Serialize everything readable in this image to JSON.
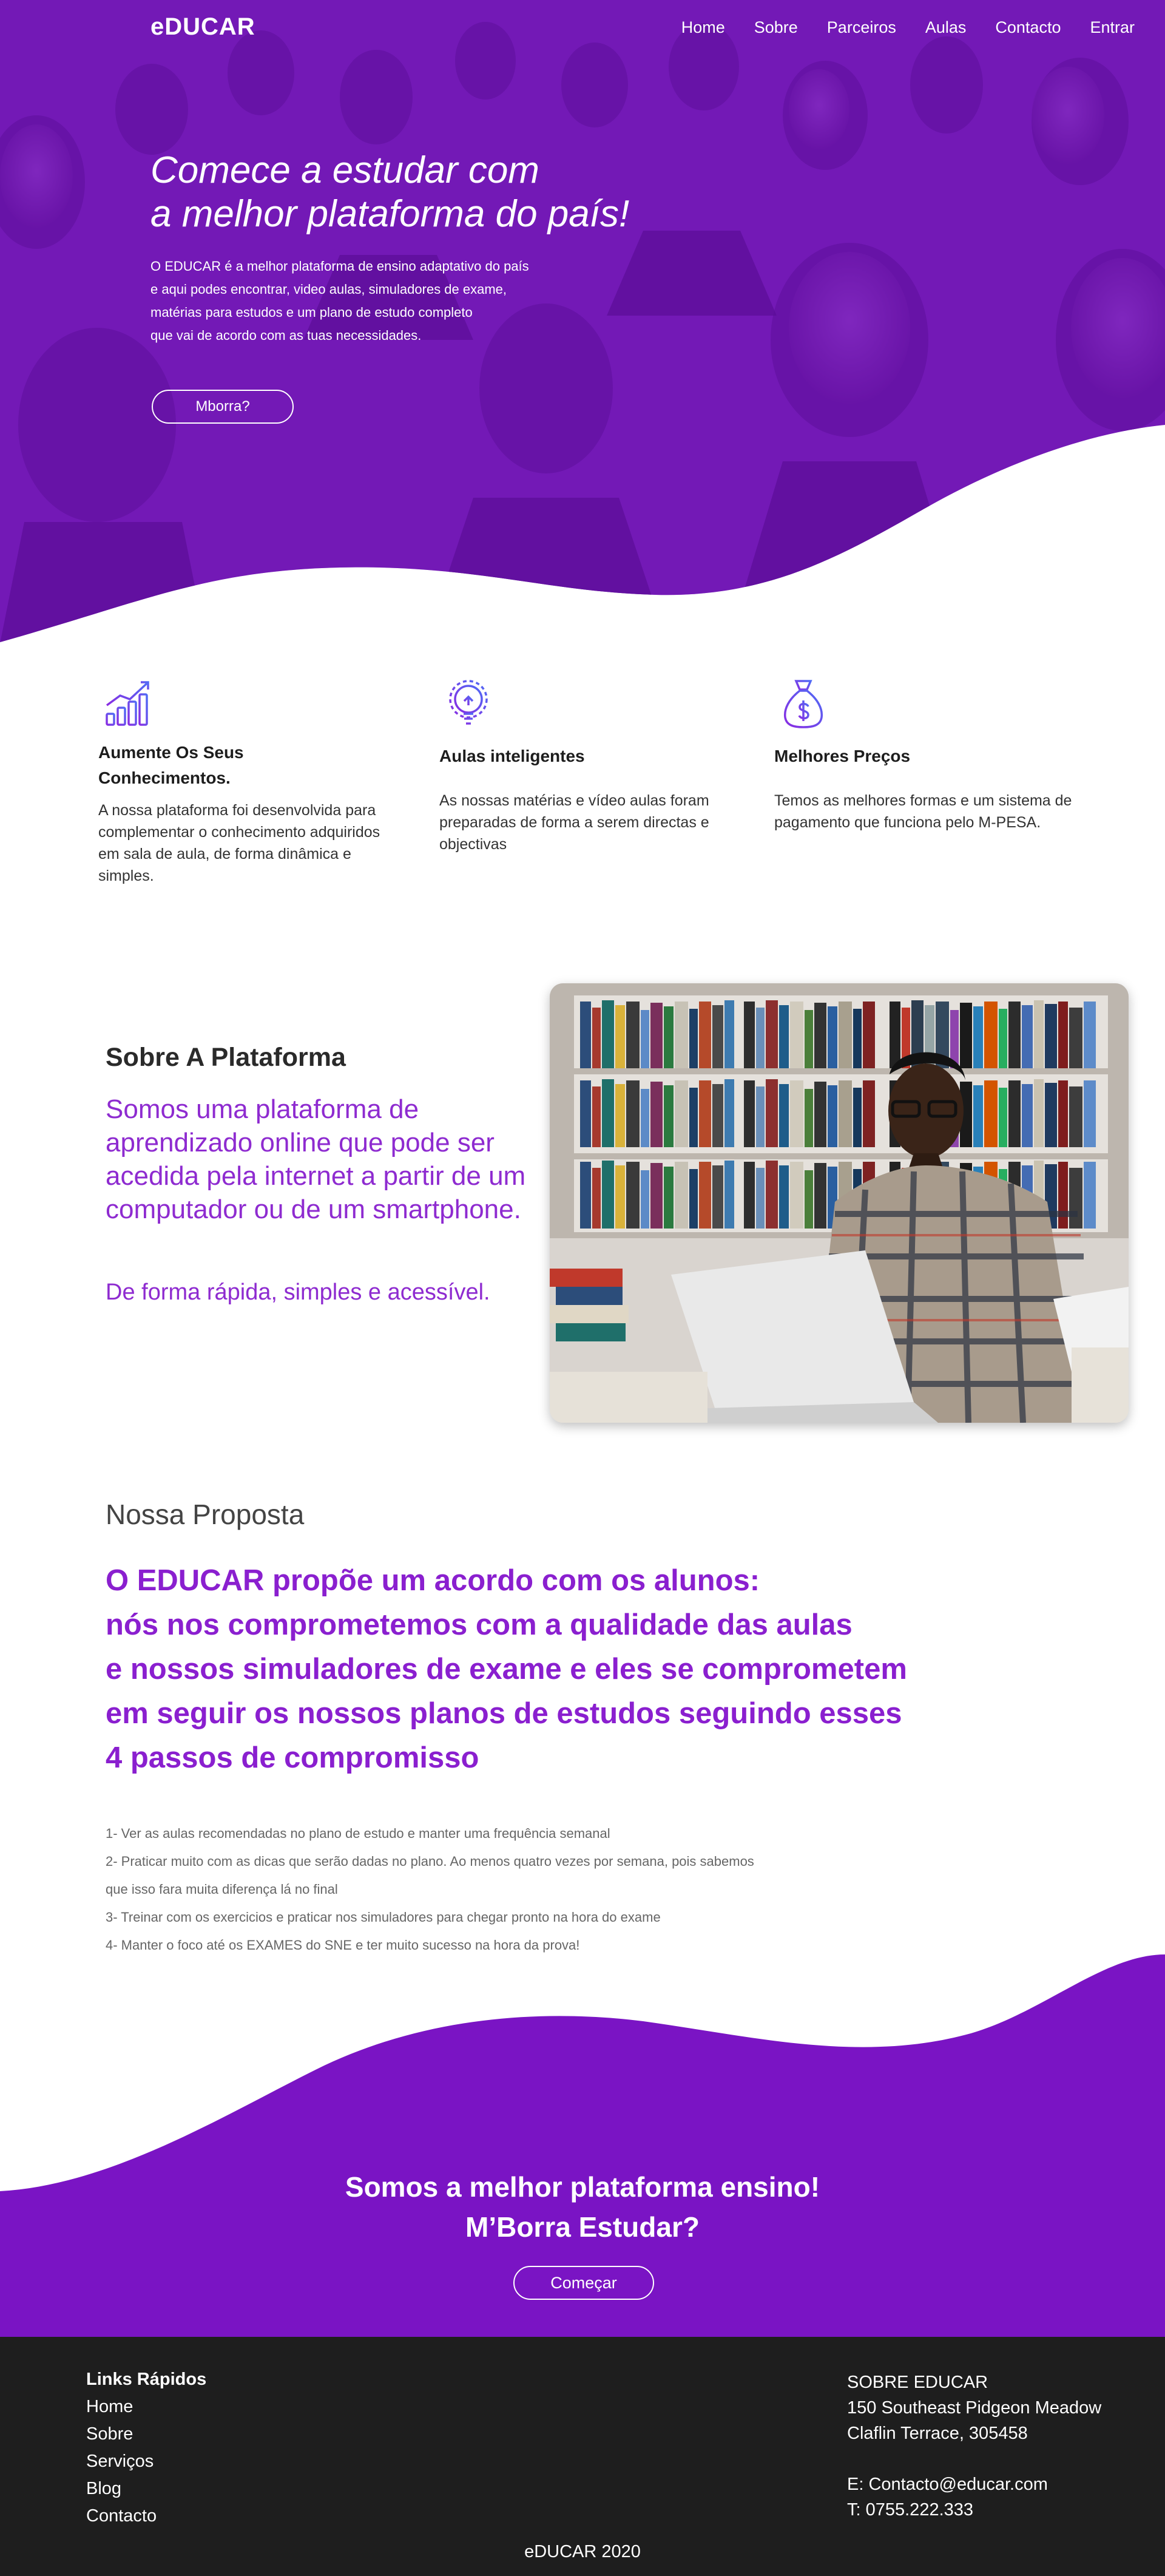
{
  "header": {
    "logo_e": "e",
    "logo_rest": "DUCAR",
    "nav": [
      "Home",
      "Sobre",
      "Parceiros",
      "Aulas",
      "Contacto",
      "Entrar"
    ]
  },
  "hero": {
    "title_line1": "Comece a estudar com",
    "title_line2": "a melhor plataforma do país!",
    "text_lines": [
      "O EDUCAR é a melhor plataforma de ensino adaptativo do país",
      "e aqui podes encontrar, video aulas, simuladores de exame,",
      "matérias para estudos e um plano de estudo completo",
      "que vai de acordo com as tuas necessidades."
    ],
    "button": "Mborra?"
  },
  "features": [
    {
      "icon": "chart-bars-icon",
      "title": "Aumente Os Seus Conhecimentos.",
      "text": "A nossa plataforma foi desenvolvida para complementar o conhecimento adquiridos em sala de aula, de forma dinâmica e simples."
    },
    {
      "icon": "lightbulb-icon",
      "title": "Aulas inteligentes",
      "text": "As nossas matérias e vídeo aulas foram preparadas de forma a serem directas e objectivas"
    },
    {
      "icon": "money-bag-icon",
      "title": "Melhores Preços",
      "text": "Temos as melhores formas e um sistema de pagamento que funciona pelo M-PESA."
    }
  ],
  "about": {
    "title": "Sobre A Plataforma",
    "text": "Somos uma plataforma de aprendizado online que pode ser acedida pela internet a partir de um computador ou de um smartphone.",
    "sub": "De forma rápida, simples e acessível."
  },
  "proposta": {
    "title": "Nossa Proposta",
    "lines": [
      "O EDUCAR propõe um acordo com os alunos:",
      "nós nos comprometemos com a qualidade das aulas",
      "e nossos simuladores de exame e eles se comprometem",
      "em seguir os nossos planos de estudos seguindo esses",
      "4 passos de compromisso"
    ],
    "steps": [
      "1- Ver as aulas recomendadas no plano de estudo e manter uma frequência semanal",
      "2- Praticar muito com as dicas que serão dadas no plano. Ao menos quatro vezes por semana, pois sabemos",
      "que isso fara muita diferença lá no final",
      "3- Treinar com os exercicios e praticar nos simuladores para chegar pronto na hora do exame",
      "4- Manter o foco até os EXAMES do SNE e ter muito sucesso na hora da prova!"
    ]
  },
  "cta": {
    "line1": "Somos a melhor plataforma ensino!",
    "line2": "M’Borra Estudar?",
    "button": "Começar"
  },
  "footer": {
    "links_title": "Links Rápidos",
    "links": [
      "Home",
      "Sobre",
      "Serviços",
      "Blog",
      "Contacto"
    ],
    "contact": {
      "title": "SOBRE EDUCAR",
      "address1": "150 Southeast Pidgeon Meadow",
      "address2": "Claflin Terrace, 305458",
      "email": "E: Contacto@educar.com",
      "phone": "T: 0755.222.333"
    },
    "copyright": "eDUCAR 2020"
  },
  "colors": {
    "primary": "#7a14c4",
    "accent_text": "#8e2bd0",
    "footer_bg": "#1e1e1e"
  }
}
